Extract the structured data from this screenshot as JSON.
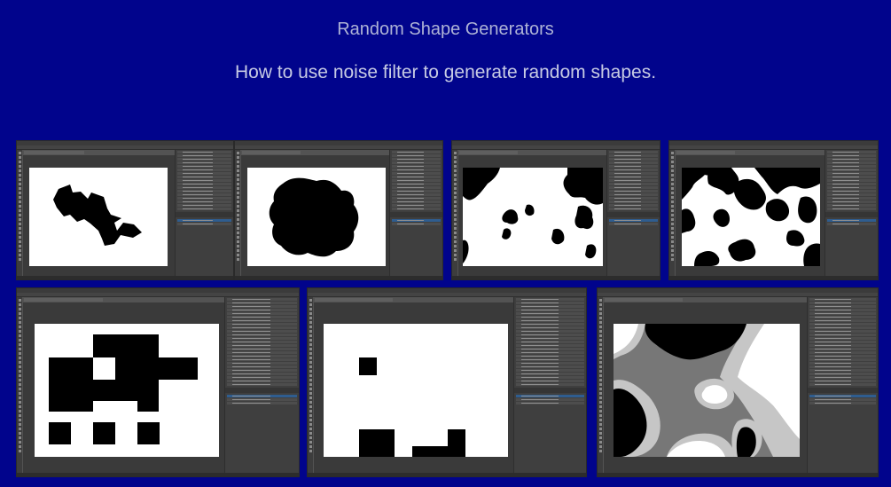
{
  "page": {
    "title": "Random Shape Generators",
    "subtitle": "How to use noise filter to generate random shapes."
  },
  "screenshots": [
    {
      "name": "noise-polygon-screenshot"
    },
    {
      "name": "noise-blob-screenshot"
    },
    {
      "name": "noise-spots-screenshot"
    },
    {
      "name": "noise-maze-screenshot"
    },
    {
      "name": "noise-pixel-blocks-screenshot"
    },
    {
      "name": "noise-sparse-blocks-screenshot"
    },
    {
      "name": "noise-contour-gray-screenshot"
    }
  ]
}
